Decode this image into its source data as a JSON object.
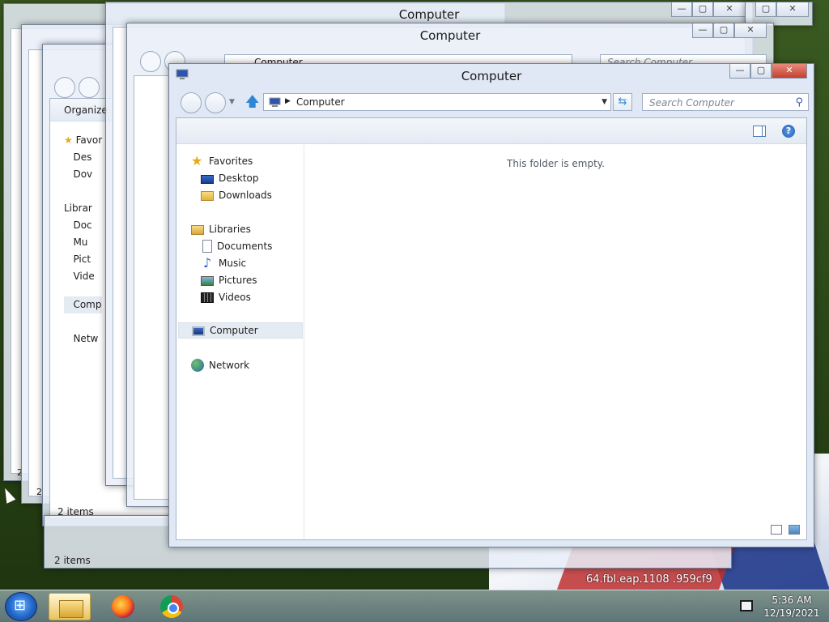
{
  "window": {
    "title": "Computer",
    "minimize": "—",
    "maximize": "▢",
    "close": "✕"
  },
  "nav": {
    "back": "",
    "forward": "",
    "up_arrow": "🡅",
    "address": "Computer",
    "refresh": "⇆",
    "search_placeholder": "Search Computer"
  },
  "sidebar": {
    "favorites": "Favorites",
    "desktop": "Desktop",
    "downloads": "Downloads",
    "libraries": "Libraries",
    "documents": "Documents",
    "music": "Music",
    "pictures": "Pictures",
    "videos": "Videos",
    "computer": "Computer",
    "network": "Network"
  },
  "content": {
    "empty": "This folder is empty."
  },
  "background_windows": {
    "organize": "Organize",
    "items_count": "2 items",
    "items_count_2": "2 items",
    "search_placeholder": "Search Computer",
    "address": "Computer"
  },
  "ghost_nav": {
    "fav": "Favor",
    "desk": "Des",
    "down": "Dov",
    "libr": "Librar",
    "docs": "Doc",
    "music": "Mu",
    "pics": "Pict",
    "vids": "Vide",
    "comp": "Comp",
    "net": "Netw"
  },
  "wallpaper_text": "64.fbl.eap.1108 .959cf9 ",
  "taskbar": {
    "time": "5:36 AM",
    "date": "12/19/2021"
  },
  "colors": {
    "selection": "#e5ebf2",
    "accent": "#2f86d6",
    "close": "#c4402f"
  }
}
